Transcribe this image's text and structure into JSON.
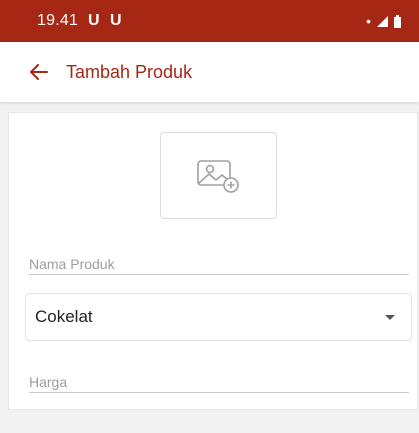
{
  "status_bar": {
    "time": "19.41",
    "notifications": "U U",
    "dot": "•",
    "background": "#a52714"
  },
  "app_bar": {
    "back_icon": "arrow-left-icon",
    "title": "Tambah Produk",
    "accent": "#a52714"
  },
  "form": {
    "image_picker_icon": "add-image-icon",
    "name_placeholder": "Nama Produk",
    "category_selected": "Cokelat",
    "price_placeholder": "Harga"
  }
}
